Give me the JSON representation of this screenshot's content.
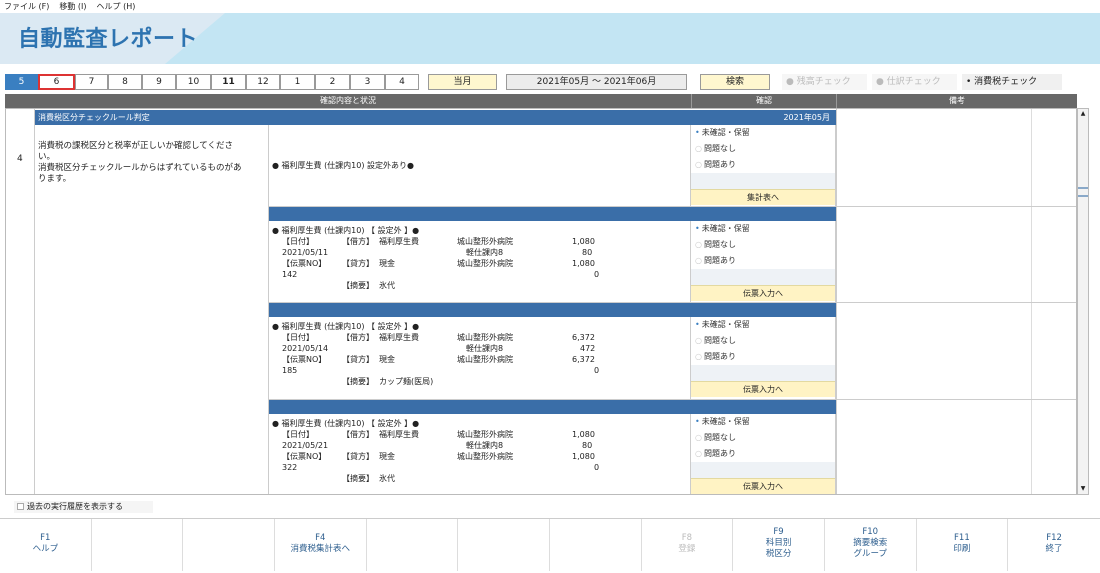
{
  "menu": [
    "ファイル (F)",
    "移動 (I)",
    "ヘルプ (H)"
  ],
  "app_title": "自動監査レポート",
  "months": [
    "5",
    "6",
    "7",
    "8",
    "9",
    "10",
    "11",
    "12",
    "1",
    "2",
    "3",
    "4"
  ],
  "current_month_btn": "当月",
  "date_range": "2021年05月 ～ 2021年06月",
  "search_btn": "検索",
  "check_tabs": [
    "残高チェック",
    "仕訳チェック",
    "消費税チェック"
  ],
  "headers": {
    "content": "確認内容と状況",
    "confirm": "確認",
    "remarks": "備考"
  },
  "rule_no": "4",
  "rule_title": "消費税区分チェックルール判定",
  "rule_period": "2021年05月",
  "rule_desc": [
    "消費税の課税区分と税率が正しいか確認してくださ",
    "い。",
    "消費税区分チェックルールからはずれているものがあ",
    "ります。"
  ],
  "summary_text": "● 福利厚生費 (仕課内10) 設定外あり●",
  "options": [
    "未確認・保留",
    "問題なし",
    "問題あり"
  ],
  "summary_btn": "集計表へ",
  "voucher_btn": "伝票入力へ",
  "entries": [
    {
      "head": "● 福利厚生費 (仕課内10) 【 設定外 】●",
      "date": "2021/05/11",
      "no": "142",
      "debit_acct": "福利厚生費",
      "debit_partner": "城山整形外病院",
      "debit_amt": "1,080",
      "tax_label": "軽仕課内8",
      "tax_amt": "80",
      "credit_acct": "現金",
      "credit_partner": "城山整形外病院",
      "credit_amt": "1,080",
      "credit_tax": "0",
      "memo": "氷代"
    },
    {
      "head": "● 福利厚生費 (仕課内10) 【 設定外 】●",
      "date": "2021/05/14",
      "no": "185",
      "debit_acct": "福利厚生費",
      "debit_partner": "城山整形外病院",
      "debit_amt": "6,372",
      "tax_label": "軽仕課内8",
      "tax_amt": "472",
      "credit_acct": "現金",
      "credit_partner": "城山整形外病院",
      "credit_amt": "6,372",
      "credit_tax": "0",
      "memo": "カップ麺(医局)"
    },
    {
      "head": "● 福利厚生費 (仕課内10) 【 設定外 】●",
      "date": "2021/05/21",
      "no": "322",
      "debit_acct": "福利厚生費",
      "debit_partner": "城山整形外病院",
      "debit_amt": "1,080",
      "tax_label": "軽仕課内8",
      "tax_amt": "80",
      "credit_acct": "現金",
      "credit_partner": "城山整形外病院",
      "credit_amt": "1,080",
      "credit_tax": "0",
      "memo": "氷代"
    }
  ],
  "labels": {
    "date": "【日付】",
    "no": "【伝票NO】",
    "debit": "【借方】",
    "credit": "【貸方】",
    "memo": "【摘要】"
  },
  "history_toggle": "過去の実行履歴を表示する",
  "fkeys": [
    {
      "k": "F1",
      "l1": "ヘルプ",
      "l2": ""
    },
    {
      "k": "",
      "l1": "",
      "l2": ""
    },
    {
      "k": "",
      "l1": "",
      "l2": ""
    },
    {
      "k": "F4",
      "l1": "消費税集計表へ",
      "l2": ""
    },
    {
      "k": "",
      "l1": "",
      "l2": ""
    },
    {
      "k": "",
      "l1": "",
      "l2": ""
    },
    {
      "k": "",
      "l1": "",
      "l2": ""
    },
    {
      "k": "F8",
      "l1": "登録",
      "l2": ""
    },
    {
      "k": "F9",
      "l1": "科目別",
      "l2": "税区分"
    },
    {
      "k": "F10",
      "l1": "摘要検索",
      "l2": "グループ"
    },
    {
      "k": "F11",
      "l1": "印刷",
      "l2": ""
    },
    {
      "k": "F12",
      "l1": "終了",
      "l2": ""
    }
  ]
}
